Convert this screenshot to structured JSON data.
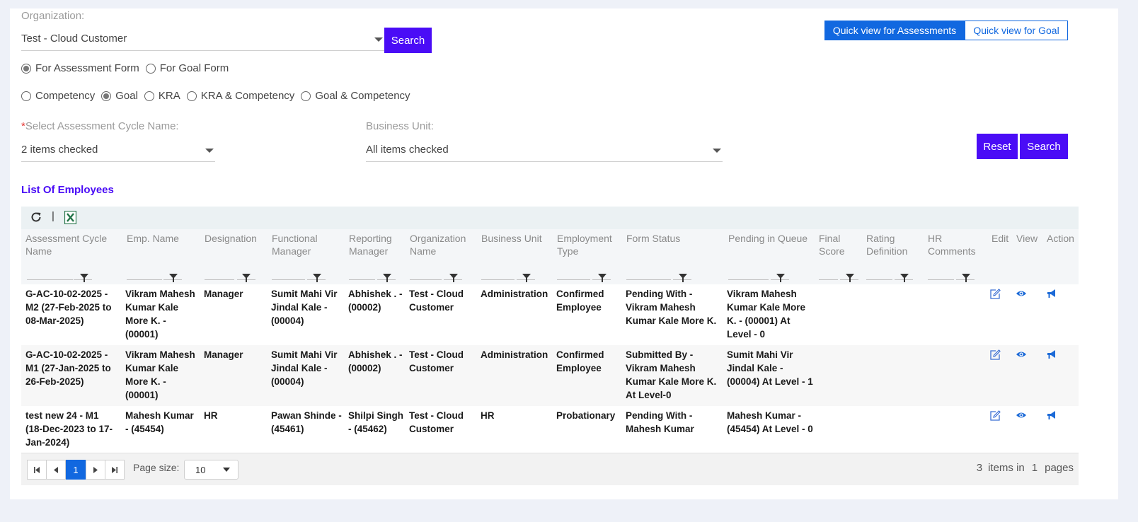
{
  "filters": {
    "organization_label": "Organization:",
    "organization_value": "Test - Cloud Customer",
    "search_label": "Search",
    "form_type_options": [
      {
        "label": "For Assessment Form",
        "checked": true
      },
      {
        "label": "For Goal Form",
        "checked": false
      }
    ],
    "category_options": [
      {
        "label": "Competency",
        "checked": false
      },
      {
        "label": "Goal",
        "checked": true
      },
      {
        "label": "KRA",
        "checked": false
      },
      {
        "label": "KRA & Competency",
        "checked": false
      },
      {
        "label": "Goal & Competency",
        "checked": false
      }
    ],
    "cycle_required_mark": "*",
    "cycle_label": "Select Assessment Cycle Name:",
    "cycle_value": "2 items checked",
    "business_unit_label": "Business Unit:",
    "business_unit_value": "All items checked",
    "reset_label": "Reset",
    "search2_label": "Search"
  },
  "quick_view": {
    "assessments_label": "Quick view for Assessments",
    "goal_label": "Quick view for Goal"
  },
  "list_title": "List Of Employees",
  "grid": {
    "toolbar_separator": "|",
    "columns": [
      "Assessment Cycle Name",
      "Emp. Name",
      "Designation",
      "Functional Manager",
      "Reporting Manager",
      "Organization Name",
      "Business Unit",
      "Employment Type",
      "Form Status",
      "Pending in Queue",
      "Final Score",
      "Rating Definition",
      "HR Comments",
      "Edit",
      "View",
      "Action"
    ],
    "rows": [
      {
        "cycle": "G-AC-10-02-2025 - M2 (27-Feb-2025 to 08-Mar-2025)",
        "emp": "Vikram Mahesh Kumar Kale More K. - (00001)",
        "designation": "Manager",
        "functional_manager": "Sumit Mahi Vir Jindal Kale - (00004)",
        "reporting_manager": "Abhishek . - (00002)",
        "organization": "Test - Cloud Customer",
        "business_unit": "Administration",
        "employment_type": "Confirmed Employee",
        "form_status": "Pending With - Vikram Mahesh Kumar Kale More K.",
        "pending_queue": "Vikram Mahesh Kumar Kale More K. - (00001) At Level - 0",
        "final_score": "",
        "rating_definition": "",
        "hr_comments": ""
      },
      {
        "cycle": "G-AC-10-02-2025 - M1 (27-Jan-2025 to 26-Feb-2025)",
        "emp": "Vikram Mahesh Kumar Kale More K. - (00001)",
        "designation": "Manager",
        "functional_manager": "Sumit Mahi Vir Jindal Kale - (00004)",
        "reporting_manager": "Abhishek . - (00002)",
        "organization": "Test - Cloud Customer",
        "business_unit": "Administration",
        "employment_type": "Confirmed Employee",
        "form_status": "Submitted By - Vikram Mahesh Kumar Kale More K. At Level-0",
        "pending_queue": "Sumit Mahi Vir Jindal Kale - (00004) At Level - 1",
        "final_score": "",
        "rating_definition": "",
        "hr_comments": ""
      },
      {
        "cycle": "test new 24 - M1 (18-Dec-2023 to 17-Jan-2024)",
        "emp": "Mahesh Kumar - (45454)",
        "designation": "HR",
        "functional_manager": "Pawan Shinde - (45461)",
        "reporting_manager": "Shilpi Singh - (45462)",
        "organization": "Test - Cloud Customer",
        "business_unit": "HR",
        "employment_type": "Probationary",
        "form_status": "Pending With - Mahesh Kumar",
        "pending_queue": "Mahesh Kumar - (45454) At Level - 0",
        "final_score": "",
        "rating_definition": "",
        "hr_comments": ""
      }
    ]
  },
  "pager": {
    "current_page": "1",
    "page_size_label": "Page size:",
    "page_size_value": "10",
    "total_items": "3",
    "items_in_label": "items in",
    "total_pages": "1",
    "pages_label": "pages"
  },
  "colors": {
    "primary": "#4a0cf6",
    "quick_view_blue": "#1168e0",
    "excel_green": "#217346"
  },
  "icons": [
    "refresh-icon",
    "excel-icon",
    "filter-icon",
    "edit-icon",
    "view-icon",
    "action-icon",
    "first-page-icon",
    "prev-page-icon",
    "next-page-icon",
    "last-page-icon",
    "caret-down-icon"
  ]
}
